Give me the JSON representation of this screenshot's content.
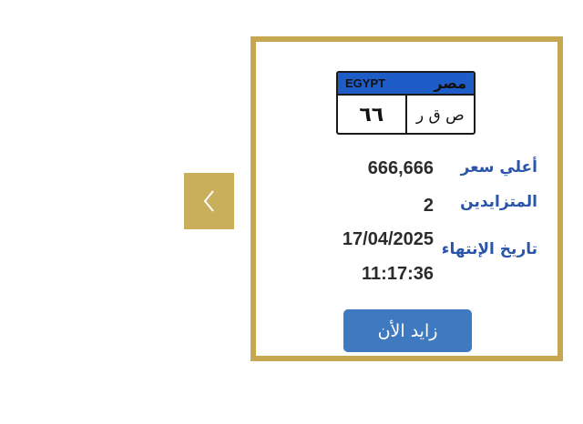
{
  "carousel": {
    "prev_icon": "chevron-left-icon"
  },
  "plate": {
    "country_en": "EGYPT",
    "country_ar": "مصر",
    "numbers": "٦٦",
    "letters": "ص ق ر"
  },
  "details": {
    "highest_price_label": "أعلي سعر",
    "highest_price_value": "666,666",
    "bidders_label": "المتزايدين",
    "bidders_value": "2",
    "expiry_label": "تاريخ الإنتهاء",
    "expiry_date": "17/04/2025",
    "expiry_time": "11:17:36"
  },
  "bid_button_label": "زايد الأن",
  "colors": {
    "accent_gold": "#c5a84f",
    "plate_blue": "#1e5cc8",
    "label_blue": "#2a55a8",
    "button_blue": "#3f7ac0"
  }
}
